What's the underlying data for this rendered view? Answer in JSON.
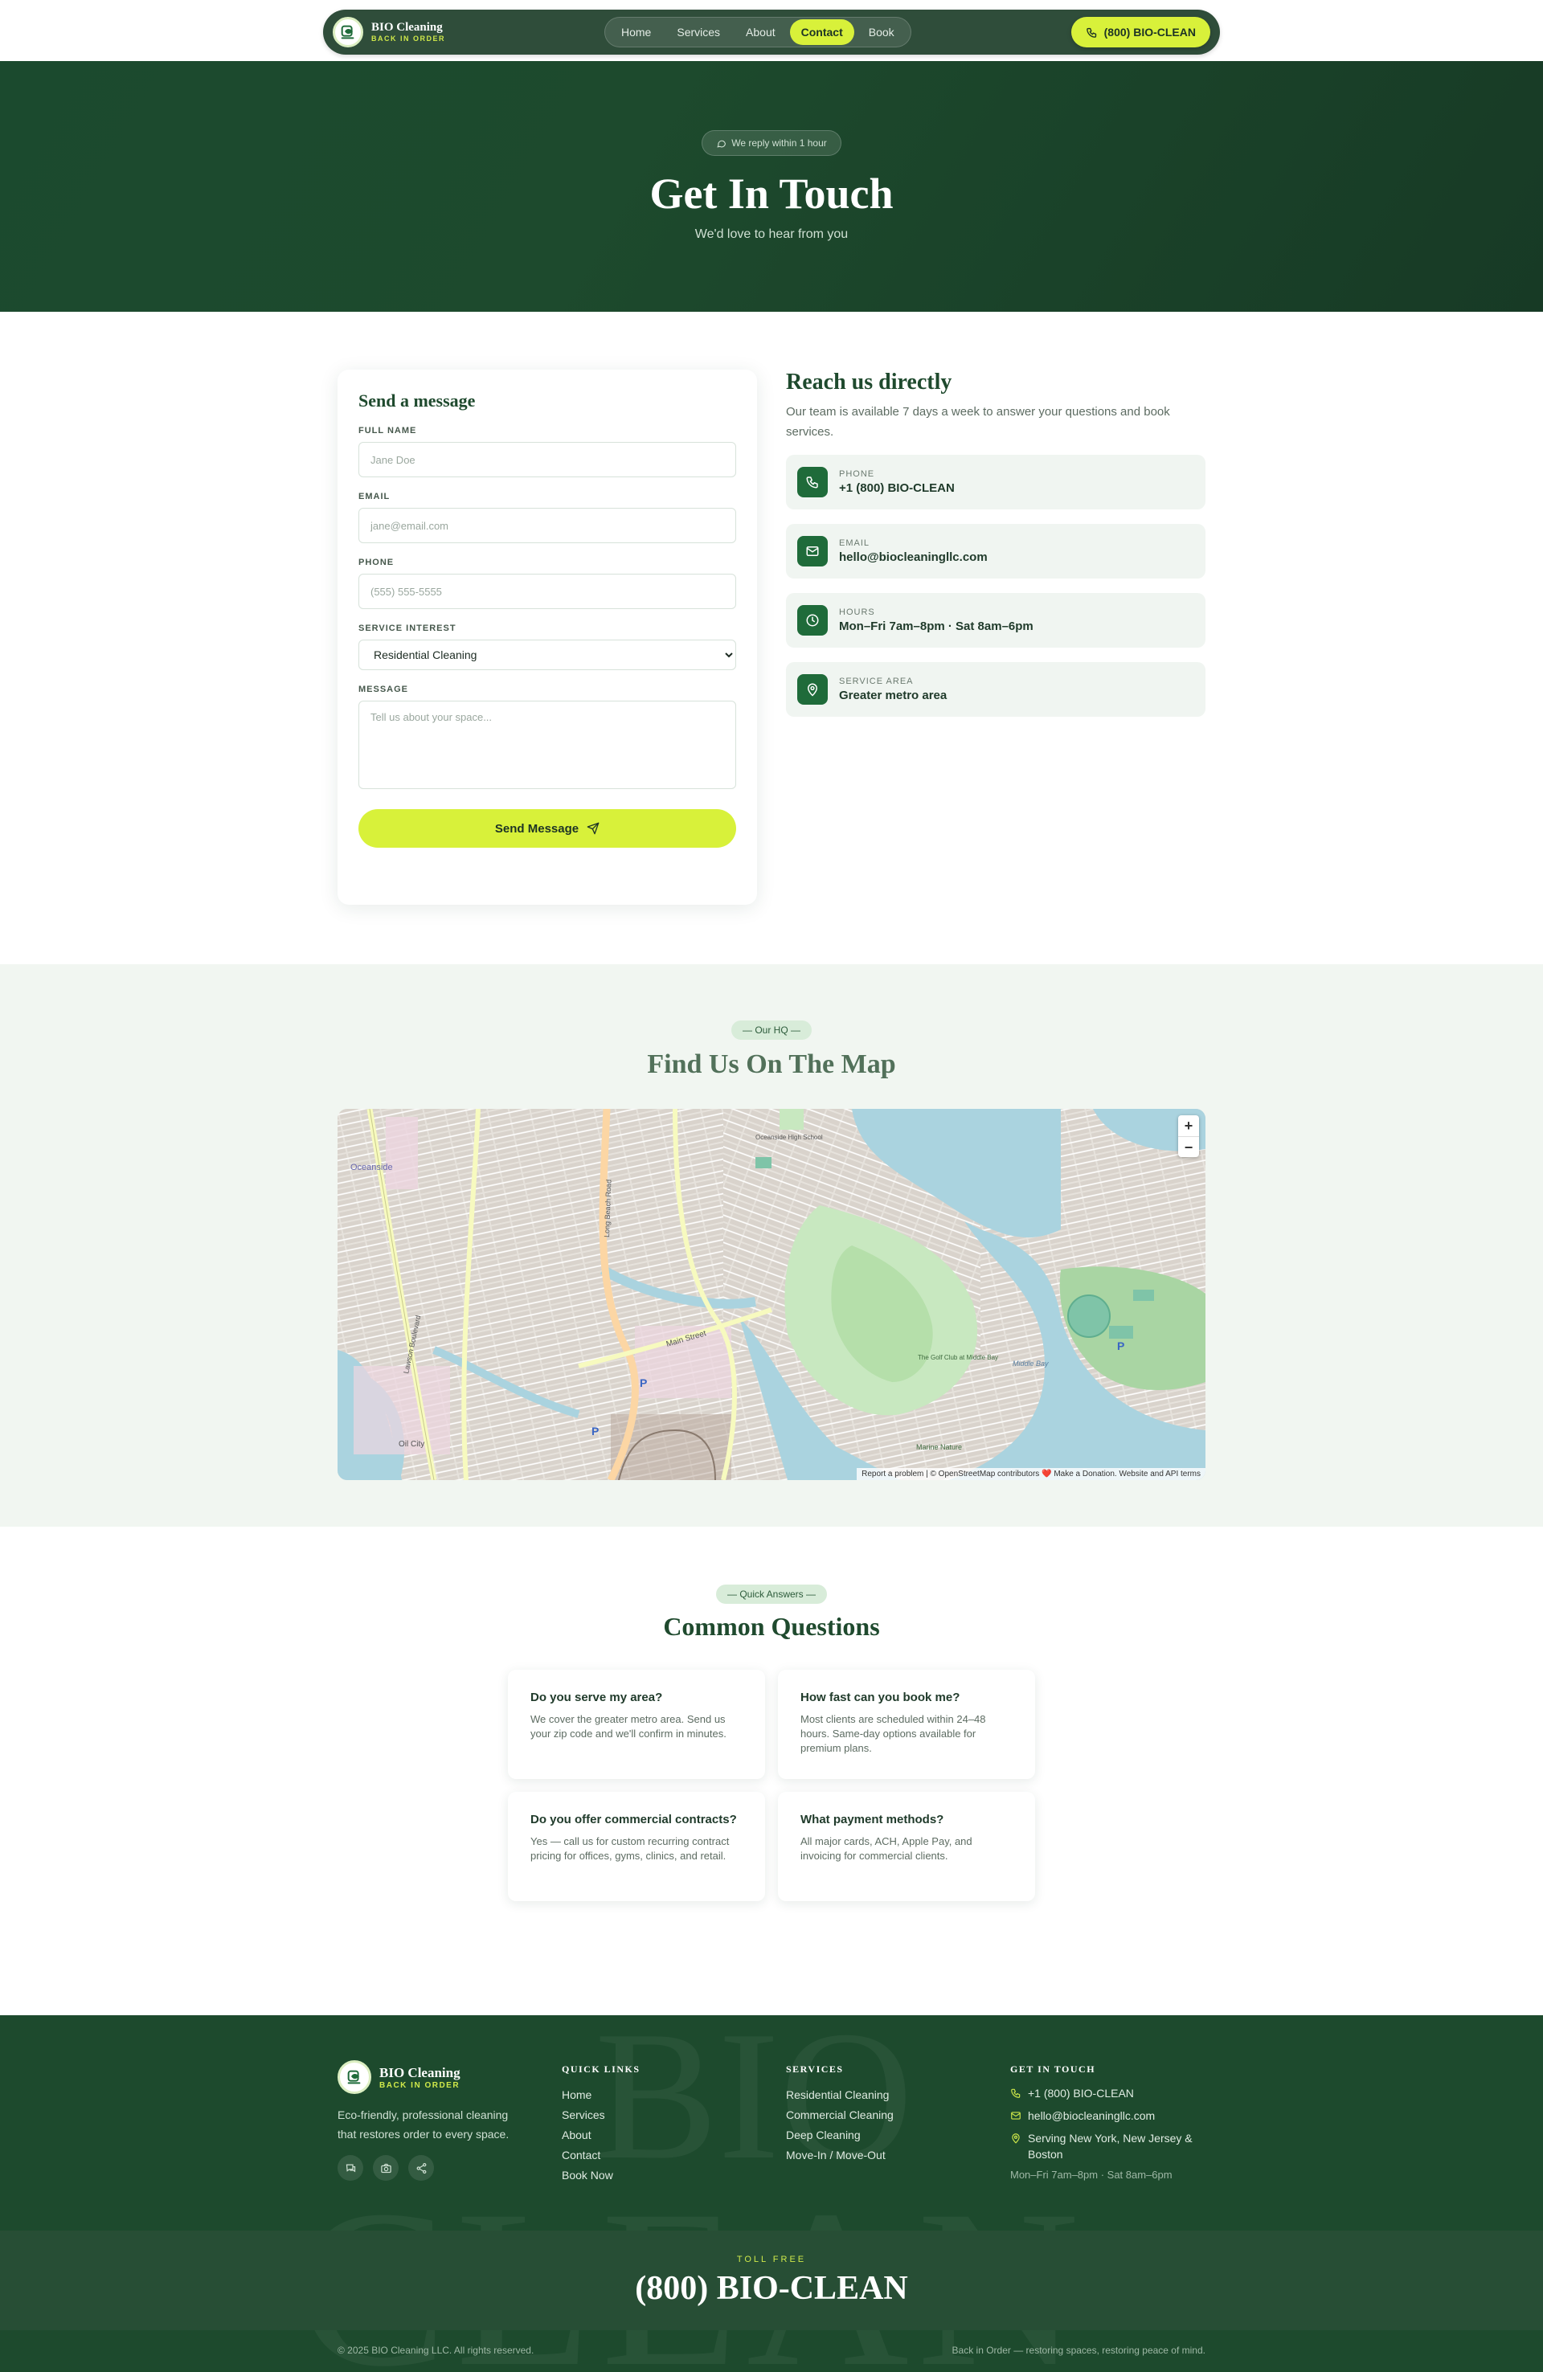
{
  "brand": {
    "name": "BIO Cleaning",
    "tagline": "BACK IN ORDER"
  },
  "nav": {
    "links": [
      "Home",
      "Services",
      "About",
      "Contact",
      "Book"
    ],
    "active": "Contact",
    "cta": "(800) BIO-CLEAN"
  },
  "hero": {
    "badge": "We reply within 1 hour",
    "title": "Get In Touch",
    "subtitle": "We'd love to hear from you"
  },
  "form": {
    "title": "Send a message",
    "name_label": "FULL NAME",
    "name_placeholder": "Jane Doe",
    "email_label": "EMAIL",
    "email_placeholder": "jane@email.com",
    "phone_label": "PHONE",
    "phone_placeholder": "(555) 555-5555",
    "service_label": "SERVICE INTEREST",
    "service_selected": "Residential Cleaning",
    "message_label": "MESSAGE",
    "message_placeholder": "Tell us about your space...",
    "submit": "Send Message"
  },
  "reach": {
    "title": "Reach us directly",
    "description": "Our team is available 7 days a week to answer your questions and book services.",
    "items": [
      {
        "label": "PHONE",
        "value": "+1 (800) BIO-CLEAN",
        "icon": "phone-icon"
      },
      {
        "label": "EMAIL",
        "value": "hello@biocleaningllc.com",
        "icon": "mail-icon"
      },
      {
        "label": "HOURS",
        "value": "Mon–Fri 7am–8pm · Sat 8am–6pm",
        "icon": "clock-icon"
      },
      {
        "label": "SERVICE AREA",
        "value": "Greater metro area",
        "icon": "map-pin-icon"
      }
    ]
  },
  "map": {
    "badge": "— Our HQ —",
    "title": "Find Us On The Map",
    "zoom_in": "+",
    "zoom_out": "−",
    "attribution": "Report a problem | © OpenStreetMap contributors ❤️ Make a Donation. Website and API terms",
    "labels": [
      "Oceanside",
      "Lawson Boulevard",
      "Long Beach Road",
      "Main Street",
      "Oil City",
      "The Golf Club at Middle Bay",
      "Middle Bay",
      "Marine Nature",
      "Oceanside High School"
    ]
  },
  "faq": {
    "badge": "— Quick Answers —",
    "title": "Common Questions",
    "items": [
      {
        "q": "Do you serve my area?",
        "a": "We cover the greater metro area. Send us your zip code and we'll confirm in minutes."
      },
      {
        "q": "How fast can you book me?",
        "a": "Most clients are scheduled within 24–48 hours. Same-day options available for premium plans."
      },
      {
        "q": "Do you offer commercial contracts?",
        "a": "Yes — call us for custom recurring contract pricing for offices, gyms, clinics, and retail."
      },
      {
        "q": "What payment methods?",
        "a": "All major cards, ACH, Apple Pay, and invoicing for commercial clients."
      }
    ]
  },
  "footer": {
    "brand_name": "BIO Cleaning",
    "brand_tag": "BACK IN ORDER",
    "description": "Eco-friendly, professional cleaning that restores order to every space.",
    "quick_links_title": "QUICK LINKS",
    "quick_links": [
      "Home",
      "Services",
      "About",
      "Contact",
      "Book Now"
    ],
    "services_title": "SERVICES",
    "services": [
      "Residential Cleaning",
      "Commercial Cleaning",
      "Deep Cleaning",
      "Move-In / Move-Out"
    ],
    "contact_title": "GET IN TOUCH",
    "phone": "+1 (800) BIO-CLEAN",
    "email": "hello@biocleaningllc.com",
    "area": "Serving New York, New Jersey & Boston",
    "hours": "Mon–Fri 7am–8pm · Sat 8am–6pm",
    "watermark_top": "BIO",
    "watermark_bottom": "CLEAN",
    "tollfree_label": "TOLL FREE",
    "tollfree_number": "(800) BIO-CLEAN",
    "copyright": "© 2025 BIO Cleaning LLC. All rights reserved.",
    "tagline_bottom": "Back in Order — restoring spaces, restoring peace of mind."
  },
  "colors": {
    "primary_green": "#1d4a2d",
    "accent_lime": "#d8f13a",
    "icon_green": "#1f6b3a"
  }
}
